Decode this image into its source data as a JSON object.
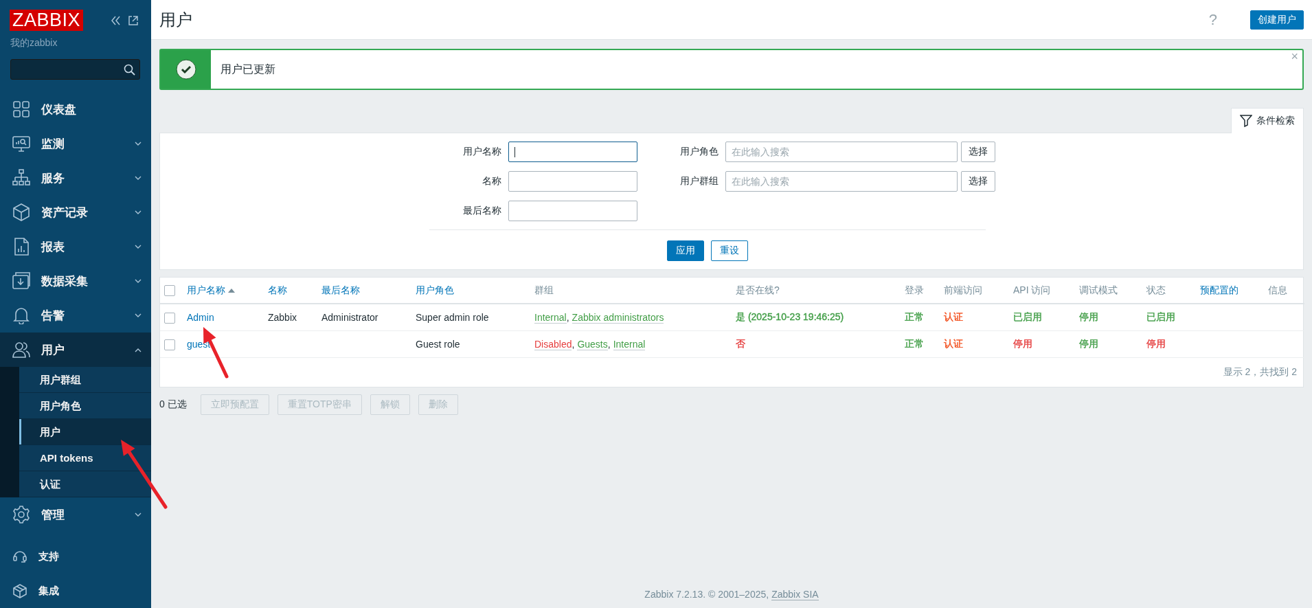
{
  "sidebar": {
    "logo": "ZABBIX",
    "subtitle": "我的zabbix",
    "menu": [
      {
        "label": "仪表盘",
        "kind": "dashboard"
      },
      {
        "label": "监测",
        "kind": "monitor",
        "expanded": false
      },
      {
        "label": "服务",
        "kind": "services",
        "expanded": false
      },
      {
        "label": "资产记录",
        "kind": "inventory",
        "expanded": false
      },
      {
        "label": "报表",
        "kind": "reports",
        "expanded": false
      },
      {
        "label": "数据采集",
        "kind": "collection",
        "expanded": false
      },
      {
        "label": "告警",
        "kind": "alerts",
        "expanded": false
      },
      {
        "label": "用户",
        "kind": "users",
        "expanded": true,
        "children": [
          {
            "label": "用户群组",
            "selected": false
          },
          {
            "label": "用户角色",
            "selected": false
          },
          {
            "label": "用户",
            "selected": true
          },
          {
            "label": "API tokens",
            "selected": false
          },
          {
            "label": "认证",
            "selected": false
          }
        ]
      },
      {
        "label": "管理",
        "kind": "admin",
        "expanded": false
      }
    ],
    "bottom": [
      {
        "label": "支持",
        "kind": "support"
      },
      {
        "label": "集成",
        "kind": "integrations"
      }
    ]
  },
  "header": {
    "title": "用户",
    "help": "?",
    "create_button": "创建用户"
  },
  "message": {
    "kind": "success",
    "text": "用户已更新",
    "close": "×"
  },
  "filter": {
    "tab": "条件检索",
    "left_fields": [
      {
        "label": "用户名称",
        "focused": true
      },
      {
        "label": "名称",
        "focused": false
      },
      {
        "label": "最后名称",
        "focused": false
      }
    ],
    "right_fields": [
      {
        "label": "用户角色",
        "placeholder": "在此输入搜索",
        "button": "选择"
      },
      {
        "label": "用户群组",
        "placeholder": "在此输入搜索",
        "button": "选择"
      }
    ],
    "apply": "应用",
    "reset": "重设"
  },
  "table": {
    "columns": [
      {
        "label": "用户名称",
        "kind": "sortable",
        "sorted": true
      },
      {
        "label": "名称",
        "kind": "sortable",
        "sorted": false
      },
      {
        "label": "最后名称",
        "kind": "sortable",
        "sorted": false
      },
      {
        "label": "用户角色",
        "kind": "sortable",
        "sorted": false
      },
      {
        "label": "群组",
        "kind": "plain"
      },
      {
        "label": "是否在线?",
        "kind": "plain"
      },
      {
        "label": "登录",
        "kind": "plain"
      },
      {
        "label": "前端访问",
        "kind": "plain"
      },
      {
        "label": "API 访问",
        "kind": "plain"
      },
      {
        "label": "调试模式",
        "kind": "plain"
      },
      {
        "label": "状态",
        "kind": "plain"
      },
      {
        "label": "预配置的",
        "kind": "sortable",
        "sorted": false
      },
      {
        "label": "信息",
        "kind": "plain"
      }
    ],
    "select_all": {
      "checked": false
    },
    "rows": [
      {
        "checked": false,
        "cells": [
          {
            "kind": "link",
            "text": "Admin"
          },
          {
            "kind": "text",
            "text": "Zabbix"
          },
          {
            "kind": "text",
            "text": "Administrator"
          },
          {
            "kind": "text",
            "text": "Super admin role"
          },
          {
            "kind": "groups",
            "separator": ",",
            "items": [
              {
                "text": "Internal",
                "color": "#429e47"
              },
              {
                "text": "Zabbix administrators",
                "color": "#429e47"
              }
            ]
          },
          {
            "kind": "text",
            "text": "是 (2025-10-23 19:46:25)",
            "color": "#429e47"
          },
          {
            "kind": "text",
            "text": "正常",
            "color": "#429e47"
          },
          {
            "kind": "text",
            "text": "认证",
            "color": "#f24f1d"
          },
          {
            "kind": "text",
            "text": "已启用",
            "color": "#429e47"
          },
          {
            "kind": "text",
            "text": "停用",
            "color": "#429e47"
          },
          {
            "kind": "text",
            "text": "已启用",
            "color": "#429e47"
          },
          {
            "kind": "empty"
          },
          {
            "kind": "empty"
          }
        ]
      },
      {
        "checked": false,
        "cells": [
          {
            "kind": "link",
            "text": "guest"
          },
          {
            "kind": "empty"
          },
          {
            "kind": "empty"
          },
          {
            "kind": "text",
            "text": "Guest role"
          },
          {
            "kind": "groups",
            "separator": ",",
            "items": [
              {
                "text": "Disabled",
                "color": "#e53e3e"
              },
              {
                "text": "Guests",
                "color": "#429e47"
              },
              {
                "text": "Internal",
                "color": "#429e47"
              }
            ]
          },
          {
            "kind": "text",
            "text": "否",
            "color": "#e53e3e"
          },
          {
            "kind": "text",
            "text": "正常",
            "color": "#429e47"
          },
          {
            "kind": "text",
            "text": "认证",
            "color": "#f24f1d"
          },
          {
            "kind": "text",
            "text": "停用",
            "color": "#e53e3e"
          },
          {
            "kind": "text",
            "text": "停用",
            "color": "#429e47"
          },
          {
            "kind": "text",
            "text": "停用",
            "color": "#e53e3e"
          },
          {
            "kind": "empty"
          },
          {
            "kind": "empty"
          }
        ]
      }
    ],
    "summary": "显示 2，共找到 2"
  },
  "actions": {
    "count": "0 已选",
    "buttons": [
      {
        "label": "立即预配置",
        "disabled": true
      },
      {
        "label": "重置TOTP密串",
        "disabled": true
      },
      {
        "label": "解锁",
        "disabled": true
      },
      {
        "label": "删除",
        "disabled": true
      }
    ]
  },
  "footer": {
    "text": "Zabbix 7.2.13. © 2001–2025,",
    "link": "Zabbix SIA"
  }
}
